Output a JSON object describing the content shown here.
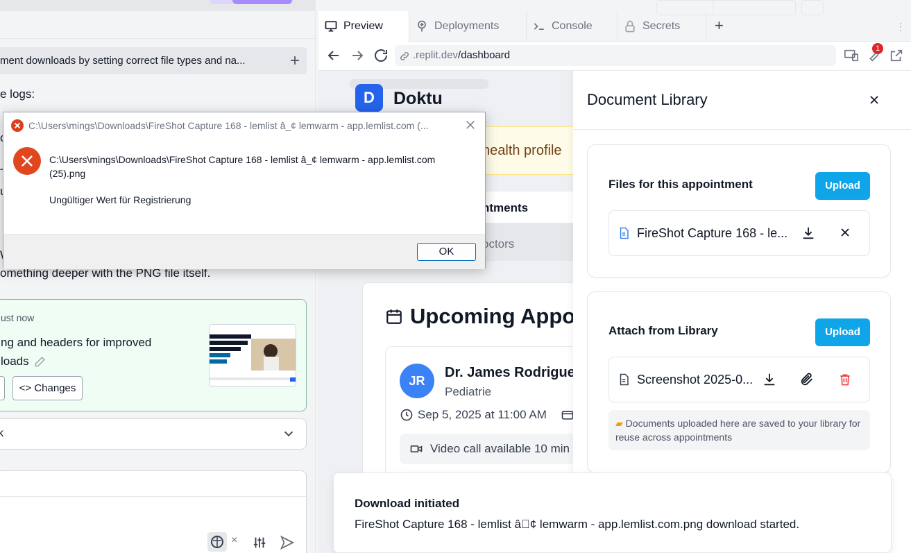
{
  "chat": {
    "title": "ment downloads by setting correct file types and na...",
    "logs_prefix": "e logs:",
    "frag_c": "c",
    "frag_t": "T",
    "frag_u": "u",
    "frag_w": "W",
    "deeper_text": "omething deeper with the PNG file itself.",
    "checkpoint": {
      "time": "ust now",
      "line1": "ng and headers for improved",
      "line2": "loads",
      "changes_label": "Changes"
    },
    "collapsed_label": "k"
  },
  "tabs": [
    {
      "label": "Preview",
      "icon": "monitor-icon"
    },
    {
      "label": "Deployments",
      "icon": "deploy-icon"
    },
    {
      "label": "Console",
      "icon": "terminal-icon"
    },
    {
      "label": "Secrets",
      "icon": "lock-icon"
    }
  ],
  "url": {
    "domain": ".replit.dev",
    "path": "/dashboard"
  },
  "notification_count": "1",
  "app": {
    "logo_letter": "D",
    "brand": "Doktu",
    "banner": "health profile",
    "tab_appointments": "ntments",
    "tab_doctors": "octors",
    "upcoming_heading": "Upcoming Appoin",
    "doctor": {
      "initials": "JR",
      "name": "Dr. James Rodriguez",
      "specialty": "Pediatrie",
      "datetime": "Sep 5, 2025 at 11:00 AM",
      "video": "Video call available 10 min"
    }
  },
  "library": {
    "title": "Document Library",
    "files_section": "Files for this appointment",
    "upload_label": "Upload",
    "file1": "FireShot Capture 168 - le...",
    "attach_section": "Attach from Library",
    "file2": "Screenshot 2025-0...",
    "note": "Documents uploaded here are saved to your library for reuse across appointments"
  },
  "toast": {
    "title": "Download initiated",
    "desc": "FireShot Capture 168 - lemlist â\u0000¢ lemwarm - app.lemlist.com.png download started."
  },
  "dialog": {
    "title": "C:\\Users\\mings\\Downloads\\FireShot Capture 168 - lemlist â_¢ lemwarm - app.lemlist.com (...",
    "path": "C:\\Users\\mings\\Downloads\\FireShot Capture 168 - lemlist â_¢ lemwarm - app.lemlist.com (25).png",
    "message": "Ungültiger Wert für Registrierung",
    "ok_label": "OK"
  },
  "colors": {
    "accent": "#0ea5e9",
    "brand": "#2563eb",
    "error": "#dc2626"
  }
}
